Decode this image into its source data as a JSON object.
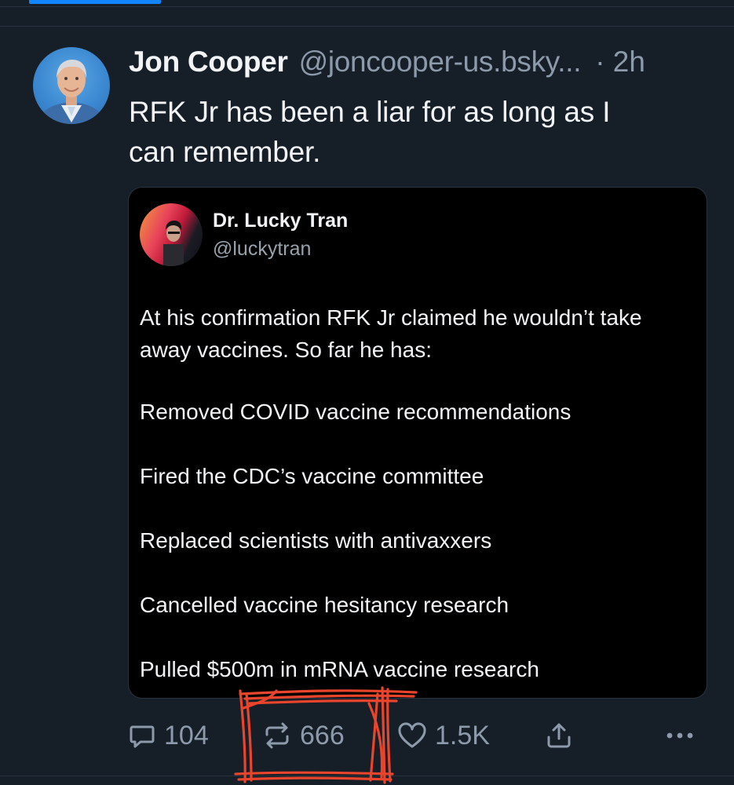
{
  "post": {
    "author_name": "Jon Cooper",
    "author_handle": "@joncooper-us.bsky...",
    "time": "· 2h",
    "text_lines": [
      "RFK Jr has been a liar for as long as I",
      "can remember."
    ]
  },
  "quote": {
    "name": "Dr. Lucky Tran",
    "handle": "@luckytran",
    "intro_lines": [
      "At his confirmation RFK Jr claimed he wouldn’t take",
      "away vaccines. So far he has:"
    ],
    "items": [
      "Removed COVID vaccine recommendations",
      "Fired the CDC’s vaccine committee",
      "Replaced scientists with antivaxxers",
      "Cancelled vaccine hesitancy research",
      "Pulled $500m in mRNA vaccine research"
    ]
  },
  "actions": {
    "replies": "104",
    "reposts": "666",
    "likes": "1.5K",
    "icons": [
      "reply-icon",
      "repost-icon",
      "like-icon",
      "share-icon",
      "more-icon"
    ]
  },
  "colors": {
    "background": "#161e27",
    "accent": "#1185fe",
    "muted_text": "#8c9aab",
    "annotation": "#e8452c"
  }
}
